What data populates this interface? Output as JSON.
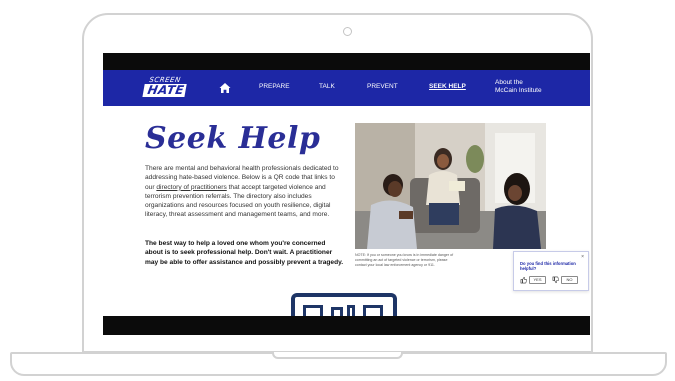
{
  "nav": {
    "logo_top": "SCREEN",
    "logo_bottom": "HATE",
    "items": [
      "PREPARE",
      "TALK",
      "PREVENT",
      "SEEK HELP"
    ],
    "about_line1": "About the",
    "about_line2": "McCain Institute"
  },
  "main": {
    "heading": "Seek Help",
    "para_before_link": "There are mental and behavioral health professionals dedicated to addressing hate-based violence. Below is a QR code that links to our ",
    "link_text": "directory of practitioners",
    "para_after_link": " that accept targeted violence and terrorism prevention referrals. The directory also includes organizations and resources focused on youth resilience, digital literacy, threat assessment and management teams, and more.",
    "bold_para": "The best way to help a loved one whom you're concerned about is to seek professional help. Don't wait. A practitioner may be able to offer assistance and possibly prevent a tragedy.",
    "note": "NOTE: If you or someone you know is in immediate danger of committing an act of targeted violence or terrorism, please contact your local law enforcement agency or 911."
  },
  "feedback": {
    "close": "×",
    "question": "Do you find this information helpful?",
    "yes": "YES",
    "no": "NO"
  },
  "colors": {
    "nav_bg": "#1d27a6",
    "heading": "#2a2e96",
    "qr_frame": "#1e3566"
  },
  "icons": [
    "home-icon",
    "thumbs-up-icon",
    "thumbs-down-icon",
    "close-icon",
    "camera-icon"
  ]
}
